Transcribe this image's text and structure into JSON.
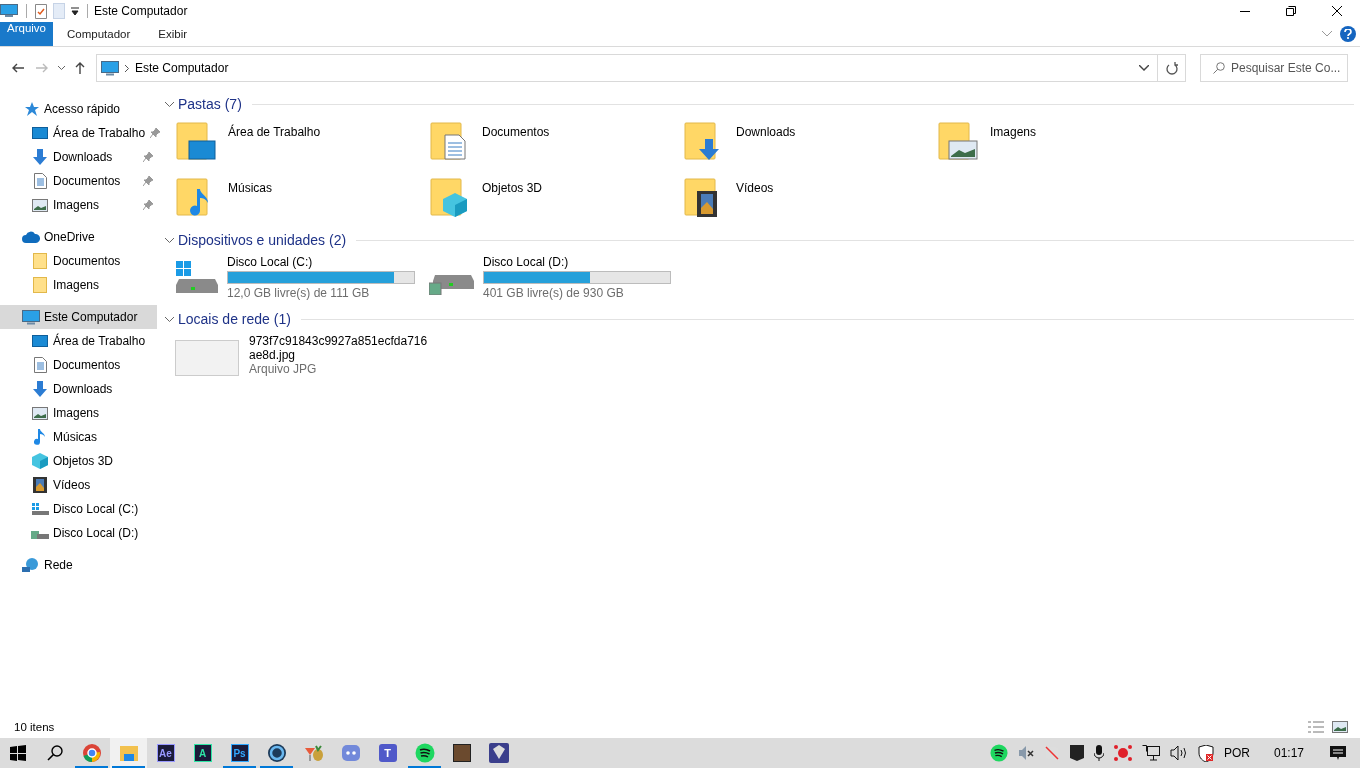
{
  "title_bar": {
    "title": "Este Computador"
  },
  "ribbon": {
    "tabs": [
      {
        "label": "Arquivo",
        "kind": "file",
        "selected": false
      },
      {
        "label": "Computador",
        "kind": "tab",
        "selected": false
      },
      {
        "label": "Exibir",
        "kind": "tab",
        "selected": false
      }
    ]
  },
  "address_bar": {
    "path": "Este Computador",
    "search_placeholder": "Pesquisar Este Co..."
  },
  "sidebar": {
    "items": [
      {
        "label": "Acesso rápido",
        "kind": "star",
        "selected": false,
        "children": [
          {
            "label": "Área de Trabalho",
            "kind": "desktop",
            "pinned": true,
            "selected": false
          },
          {
            "label": "Downloads",
            "kind": "download",
            "pinned": true,
            "selected": false
          },
          {
            "label": "Documentos",
            "kind": "document",
            "pinned": true,
            "selected": false
          },
          {
            "label": "Imagens",
            "kind": "picture",
            "pinned": true,
            "selected": false
          }
        ]
      },
      {
        "label": "OneDrive",
        "kind": "cloud",
        "selected": false,
        "children": [
          {
            "label": "Documentos",
            "kind": "folder",
            "pinned": false,
            "selected": false
          },
          {
            "label": "Imagens",
            "kind": "folder",
            "pinned": false,
            "selected": false
          }
        ]
      },
      {
        "label": "Este Computador",
        "kind": "computer",
        "selected": true,
        "children": [
          {
            "label": "Área de Trabalho",
            "kind": "desktop",
            "pinned": false,
            "selected": false
          },
          {
            "label": "Documentos",
            "kind": "document",
            "pinned": false,
            "selected": false
          },
          {
            "label": "Downloads",
            "kind": "download",
            "pinned": false,
            "selected": false
          },
          {
            "label": "Imagens",
            "kind": "picture",
            "pinned": false,
            "selected": false
          },
          {
            "label": "Músicas",
            "kind": "music",
            "pinned": false,
            "selected": false
          },
          {
            "label": "Objetos 3D",
            "kind": "cube",
            "pinned": false,
            "selected": false
          },
          {
            "label": "Vídeos",
            "kind": "film",
            "pinned": false,
            "selected": false
          },
          {
            "label": "Disco Local (C:)",
            "kind": "drive-windows",
            "pinned": false,
            "selected": false
          },
          {
            "label": "Disco Local (D:)",
            "kind": "drive",
            "pinned": false,
            "selected": false
          }
        ]
      },
      {
        "label": "Rede",
        "kind": "network",
        "selected": false
      }
    ]
  },
  "groups": [
    {
      "title": "Pastas (7)",
      "kind": "folders",
      "items": [
        {
          "name": "Área de Trabalho",
          "kind": "desktop"
        },
        {
          "name": "Documentos",
          "kind": "document"
        },
        {
          "name": "Downloads",
          "kind": "download"
        },
        {
          "name": "Imagens",
          "kind": "picture"
        },
        {
          "name": "Músicas",
          "kind": "music"
        },
        {
          "name": "Objetos 3D",
          "kind": "cube"
        },
        {
          "name": "Vídeos",
          "kind": "film"
        }
      ]
    },
    {
      "title": "Dispositivos e unidades (2)",
      "kind": "drives",
      "items": [
        {
          "name": "Disco Local (C:)",
          "kind": "drive-windows",
          "level": 0.89,
          "free": "12,0 GB livre(s) de 111 GB"
        },
        {
          "name": "Disco Local (D:)",
          "kind": "drive",
          "level": 0.57,
          "free": "401 GB livre(s) de 930 GB"
        }
      ]
    },
    {
      "title": "Locais de rede (1)",
      "kind": "files",
      "items": [
        {
          "name": "973f7c91843c9927a851ecfda716ae8d.jpg",
          "type": "Arquivo JPG"
        }
      ]
    }
  ],
  "status_bar": {
    "count": "10 itens"
  },
  "taskbar": {
    "apps": [
      {
        "kind": "chrome",
        "running": true,
        "selected": false
      },
      {
        "kind": "explorer",
        "running": true,
        "selected": true
      },
      {
        "kind": "ae",
        "glyph": "Ae",
        "running": false,
        "selected": false
      },
      {
        "kind": "animate",
        "glyph": "A",
        "running": false,
        "selected": false
      },
      {
        "kind": "ps",
        "glyph": "Ps",
        "running": true,
        "selected": false
      },
      {
        "kind": "ring",
        "running": true,
        "selected": false
      },
      {
        "kind": "cocktail",
        "running": false,
        "selected": false
      },
      {
        "kind": "discord",
        "running": false,
        "selected": false
      },
      {
        "kind": "teams",
        "glyph": "T",
        "running": false,
        "selected": false
      },
      {
        "kind": "spotify",
        "running": true,
        "selected": false
      },
      {
        "kind": "photo",
        "running": false,
        "selected": false
      },
      {
        "kind": "game",
        "running": false,
        "selected": false
      }
    ],
    "language": "POR",
    "time": "01:17"
  }
}
